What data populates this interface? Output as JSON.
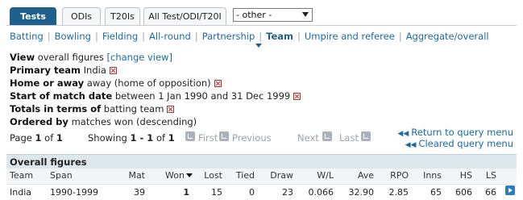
{
  "tabs": [
    {
      "label": "Tests",
      "active": true
    },
    {
      "label": "ODIs",
      "active": false
    },
    {
      "label": "T20Is",
      "active": false
    },
    {
      "label": "All Test/ODI/T20I",
      "active": false
    }
  ],
  "other_select": {
    "value": "- other -"
  },
  "subnav": [
    {
      "label": "Batting",
      "active": false
    },
    {
      "label": "Bowling",
      "active": false
    },
    {
      "label": "Fielding",
      "active": false
    },
    {
      "label": "All-round",
      "active": false
    },
    {
      "label": "Partnership",
      "active": false
    },
    {
      "label": "Team",
      "active": true
    },
    {
      "label": "Umpire and referee",
      "active": false
    },
    {
      "label": "Aggregate/overall",
      "active": false
    }
  ],
  "summary": {
    "view_label": "View",
    "view_value": "overall figures",
    "change_view": "[change view]",
    "primary_team_label": "Primary team",
    "primary_team_value": "India",
    "home_away_label": "Home or away",
    "home_away_value": "away (home of opposition)",
    "start_date_label": "Start of match date",
    "start_date_value": "between 1 Jan 1990 and 31 Dec 1999",
    "totals_label": "Totals in terms of",
    "totals_value": "batting team",
    "ordered_label": "Ordered by",
    "ordered_value": "matches won (descending)"
  },
  "pager": {
    "page_prefix": "Page",
    "page": "1",
    "of": "of",
    "pages": "1",
    "showing_prefix": "Showing",
    "range": "1 - 1",
    "of2": "of",
    "total": "1",
    "first": "First",
    "previous": "Previous",
    "next": "Next",
    "last": "Last"
  },
  "return_links": {
    "return": "Return to query menu",
    "cleared": "Cleared query menu"
  },
  "table": {
    "caption": "Overall figures",
    "columns": [
      "Team",
      "Span",
      "Mat",
      "Won",
      "Lost",
      "Tied",
      "Draw",
      "W/L",
      "Ave",
      "RPO",
      "Inns",
      "HS",
      "LS"
    ],
    "rows": [
      [
        "India",
        "1990-1999",
        "39",
        "1",
        "15",
        "0",
        "23",
        "0.066",
        "32.90",
        "2.85",
        "65",
        "606",
        "66"
      ]
    ]
  }
}
